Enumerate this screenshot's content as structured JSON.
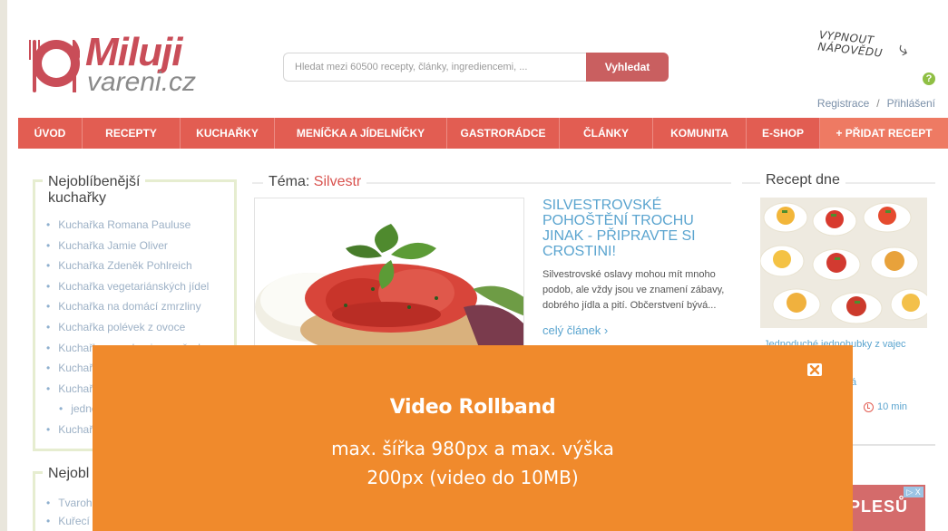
{
  "header": {
    "logo_title": "Miluji",
    "logo_sub": "vareni.cz",
    "search_placeholder": "Hledat mezi 60500 recepty, články, ingrediencemi, ...",
    "search_button": "Vyhledat",
    "help_line1": "VYPNOUT",
    "help_line2": "NÁPOVĚDU",
    "register": "Registrace",
    "separator": "/",
    "login": "Přihlášení"
  },
  "nav": {
    "items": [
      "ÚVOD",
      "RECEPTY",
      "KUCHAŘKY",
      "MENÍČKA A JÍDELNÍČKY",
      "GASTRORÁDCE",
      "ČLÁNKY",
      "KOMUNITA",
      "E-SHOP",
      "+ PŘIDAT RECEPT"
    ]
  },
  "left": {
    "title_line1": "Nejoblíbenější",
    "title_line2": "kuchařky",
    "items": [
      "Kuchařka Romana Pauluse",
      "Kuchařka Jamie Oliver",
      "Kuchařka Zdeněk Pohlreich",
      "Kuchařka vegetariánských jídel",
      "Kuchařka na domácí zmrzliny",
      "Kuchařka polévek z ovoce",
      "Kuchařka pro alergie na ořechy",
      "Kuchař",
      "Kuchař",
      "jednoh",
      "Kuchař"
    ],
    "title2": "Nejobl",
    "items2": [
      "Tvaroh",
      "Kuřecí"
    ]
  },
  "center": {
    "topic_label": "Téma:",
    "topic_value": "Silvestr",
    "article_title": "SILVESTROVSKÉ POHOŠTĚNÍ TROCHU JINAK - PŘIPRAVTE SI CROSTINI!",
    "article_desc": "Silvestrovské oslavy mohou mít mnoho podob, ale vždy jsou ve znamení zábavy, dobrého jídla a pití. Občerstvení bývá...",
    "article_more": "celý článek ›"
  },
  "right": {
    "title": "Recept dne",
    "recipe_name": "Jednoduché jednohubky z vajec",
    "recipe_extra": "á",
    "recipe_time": "10 min",
    "ad_text": "PLESŮ",
    "ad_choice": "▷ X"
  },
  "rollband": {
    "title": "Video Rollband",
    "line1": "max. šířka 980px a max. výška",
    "line2": "200px (video do 10MB)"
  },
  "colors": {
    "brand": "#e25d52",
    "rollband": "#f08a2c",
    "link": "#5aa4cf"
  }
}
